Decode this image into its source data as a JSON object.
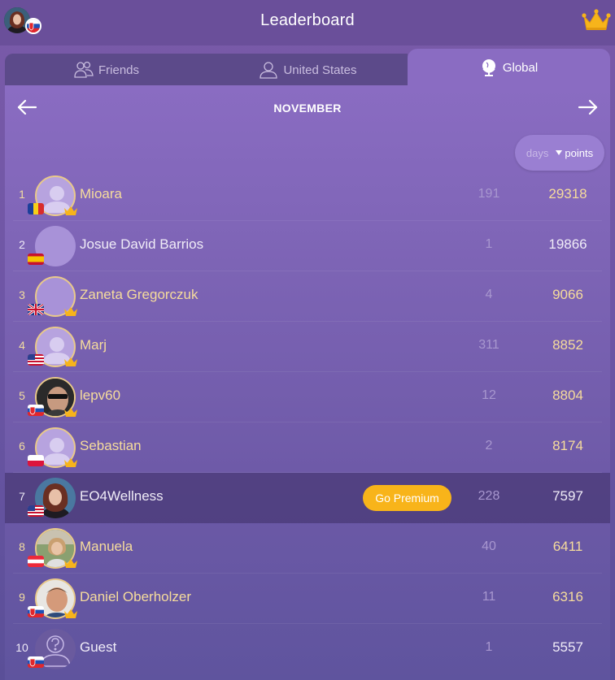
{
  "header": {
    "title": "Leaderboard"
  },
  "tabs": [
    {
      "label": "Friends",
      "icon": "friends-icon",
      "active": false
    },
    {
      "label": "United States",
      "icon": "person-icon",
      "active": false
    },
    {
      "label": "Global",
      "icon": "globe-icon",
      "active": true
    }
  ],
  "period": {
    "month": "NOVEMBER"
  },
  "sort": {
    "days_label": "days",
    "points_label": "points",
    "selected": "points"
  },
  "colors": {
    "accent_gold": "#f6dc9c",
    "premium": "#f8b41a",
    "active_tab": "#8a6cc2"
  },
  "leaderboard": [
    {
      "rank": "1",
      "name": "Mioara",
      "days": "191",
      "points": "29318",
      "flag": "ro",
      "crown": true,
      "avatar": "placeholder"
    },
    {
      "rank": "2",
      "name": "Josue David Barrios",
      "days": "1",
      "points": "19866",
      "flag": "es",
      "crown": false,
      "avatar": "blank"
    },
    {
      "rank": "3",
      "name": "Zaneta Gregorczuk",
      "days": "4",
      "points": "9066",
      "flag": "gb",
      "crown": true,
      "avatar": "blank"
    },
    {
      "rank": "4",
      "name": "Marj",
      "days": "311",
      "points": "8852",
      "flag": "us",
      "crown": true,
      "avatar": "placeholder"
    },
    {
      "rank": "5",
      "name": "lepv60",
      "days": "12",
      "points": "8804",
      "flag": "sk",
      "crown": true,
      "avatar": "photo"
    },
    {
      "rank": "6",
      "name": "Sebastian",
      "days": "2",
      "points": "8174",
      "flag": "pl",
      "crown": true,
      "avatar": "placeholder"
    },
    {
      "rank": "7",
      "name": "EO4Wellness",
      "days": "228",
      "points": "7597",
      "flag": "us",
      "crown": false,
      "avatar": "photo",
      "is_me": true,
      "premium_label": "Go Premium"
    },
    {
      "rank": "8",
      "name": "Manuela",
      "days": "40",
      "points": "6411",
      "flag": "at",
      "crown": true,
      "avatar": "photo"
    },
    {
      "rank": "9",
      "name": "Daniel Oberholzer",
      "days": "11",
      "points": "6316",
      "flag": "sk",
      "crown": true,
      "avatar": "photo"
    },
    {
      "rank": "10",
      "name": "Guest",
      "days": "1",
      "points": "5557",
      "flag": "sk",
      "crown": false,
      "avatar": "guest"
    }
  ]
}
